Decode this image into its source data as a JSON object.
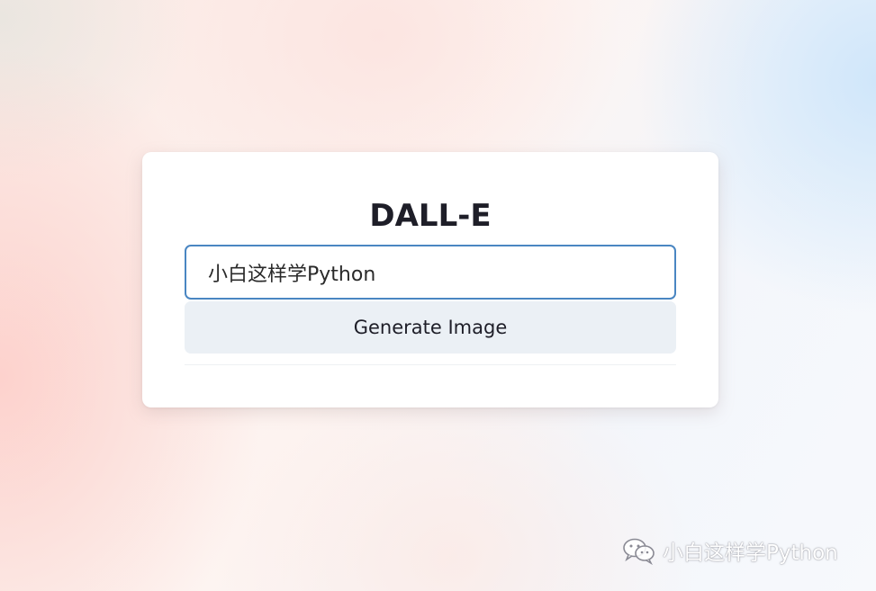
{
  "card": {
    "title": "DALL-E",
    "prompt_input_value": "小白这样学Python",
    "generate_button_label": "Generate Image"
  },
  "watermark": {
    "icon": "wechat-icon",
    "text": "小白这样学Python"
  },
  "colors": {
    "input_border": "#4a86c2",
    "button_background": "#ebf0f5",
    "title_text": "#1e1e28"
  }
}
